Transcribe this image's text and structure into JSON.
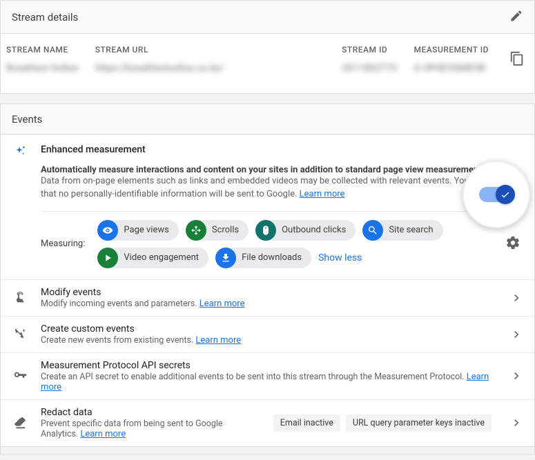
{
  "stream_details": {
    "header": "Stream details",
    "columns": {
      "name_label": "STREAM NAME",
      "url_label": "STREAM URL",
      "id_label": "STREAM ID",
      "mid_label": "MEASUREMENT ID"
    },
    "values": {
      "name": "Breakfast Online",
      "url": "https://breakfastonline.co.ke/",
      "id": "2011802775",
      "mid": "G-0P0EVQME9B"
    }
  },
  "events": {
    "header": "Events",
    "enhanced": {
      "title": "Enhanced measurement",
      "bold": "Automatically measure interactions and content on your sites in addition to standard page view measurement.",
      "desc": "Data from on-page elements such as links and embedded videos may be collected with relevant events. You must ensure that no personally-identifiable information will be sent to Google.",
      "learn_more": "Learn more",
      "toggle_on": true
    },
    "measuring": {
      "label": "Measuring:",
      "chips": [
        {
          "icon": "eye",
          "color": "blue",
          "label": "Page views"
        },
        {
          "icon": "scroll",
          "color": "green",
          "label": "Scrolls"
        },
        {
          "icon": "click",
          "color": "teal",
          "label": "Outbound clicks"
        },
        {
          "icon": "search",
          "color": "blue",
          "label": "Site search"
        },
        {
          "icon": "play",
          "color": "green",
          "label": "Video engagement"
        },
        {
          "icon": "download",
          "color": "blue",
          "label": "File downloads"
        }
      ],
      "show_less": "Show less"
    },
    "rows": [
      {
        "icon": "touch",
        "title": "Modify events",
        "desc": "Modify incoming events and parameters.",
        "learn_more": "Learn more"
      },
      {
        "icon": "sparkle-cursor",
        "title": "Create custom events",
        "desc": "Create new events from existing events.",
        "learn_more": "Learn more"
      },
      {
        "icon": "key",
        "title": "Measurement Protocol API secrets",
        "desc": "Create an API secret to enable additional events to be sent into this stream through the Measurement Protocol.",
        "learn_more": "Learn more"
      },
      {
        "icon": "erase",
        "title": "Redact data",
        "desc": "Prevent specific data from being sent to Google Analytics.",
        "learn_more": "Learn more",
        "tags": [
          "Email inactive",
          "URL query parameter keys inactive"
        ]
      }
    ]
  }
}
